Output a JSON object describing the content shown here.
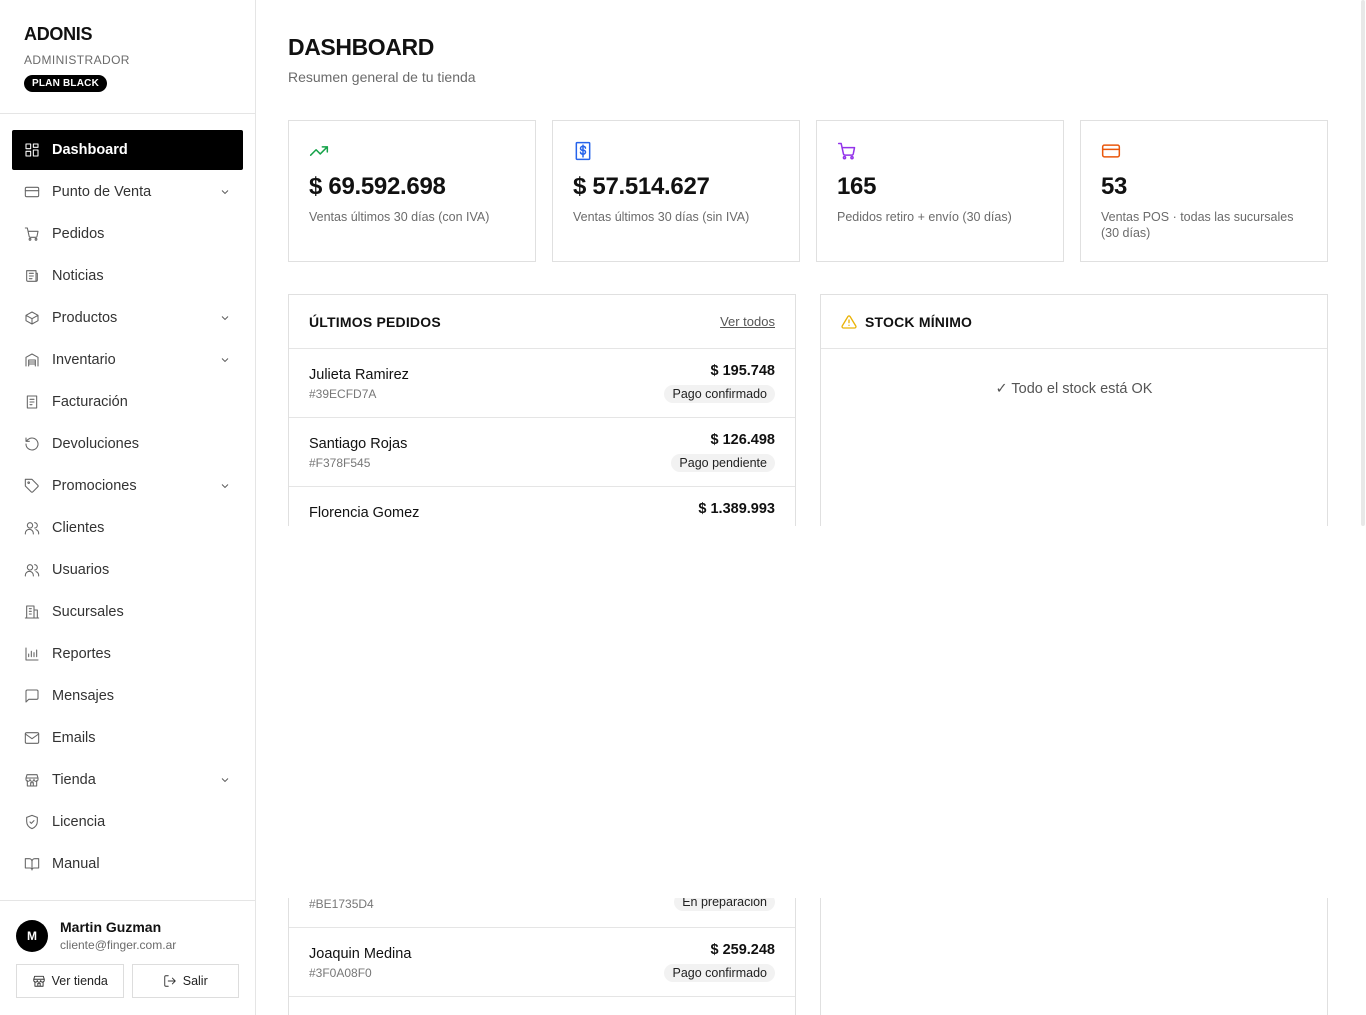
{
  "brand": {
    "name": "ADONIS",
    "role": "ADMINISTRADOR",
    "plan": "PLAN BLACK"
  },
  "nav": [
    {
      "label": "Dashboard",
      "icon": "grid-icon",
      "active": true,
      "expandable": false
    },
    {
      "label": "Punto de Venta",
      "icon": "credit-card-icon",
      "expandable": true
    },
    {
      "label": "Pedidos",
      "icon": "cart-icon",
      "expandable": false
    },
    {
      "label": "Noticias",
      "icon": "newspaper-icon",
      "expandable": false
    },
    {
      "label": "Productos",
      "icon": "box-icon",
      "expandable": true
    },
    {
      "label": "Inventario",
      "icon": "warehouse-icon",
      "expandable": true
    },
    {
      "label": "Facturación",
      "icon": "invoice-icon",
      "expandable": false
    },
    {
      "label": "Devoluciones",
      "icon": "undo-icon",
      "expandable": false
    },
    {
      "label": "Promociones",
      "icon": "tag-icon",
      "expandable": true
    },
    {
      "label": "Clientes",
      "icon": "users-icon",
      "expandable": false
    },
    {
      "label": "Usuarios",
      "icon": "users-icon",
      "expandable": false
    },
    {
      "label": "Sucursales",
      "icon": "building-icon",
      "expandable": false
    },
    {
      "label": "Reportes",
      "icon": "bar-chart-icon",
      "expandable": false
    },
    {
      "label": "Mensajes",
      "icon": "message-icon",
      "expandable": false
    },
    {
      "label": "Emails",
      "icon": "mail-icon",
      "expandable": false
    },
    {
      "label": "Tienda",
      "icon": "store-icon",
      "expandable": true
    },
    {
      "label": "Licencia",
      "icon": "shield-check-icon",
      "expandable": false
    },
    {
      "label": "Manual",
      "icon": "book-icon",
      "expandable": false
    }
  ],
  "user": {
    "initial": "M",
    "name": "Martin Guzman",
    "email": "cliente@finger.com.ar",
    "view_store_label": "Ver tienda",
    "logout_label": "Salir"
  },
  "page": {
    "title": "DASHBOARD",
    "subtitle": "Resumen general de tu tienda"
  },
  "stats": [
    {
      "icon": "trending-up-icon",
      "color": "#16a34a",
      "value": "$ 69.592.698",
      "label": "Ventas últimos 30 días (con IVA)"
    },
    {
      "icon": "dollar-receipt-icon",
      "color": "#2563eb",
      "value": "$ 57.514.627",
      "label": "Ventas últimos 30 días (sin IVA)"
    },
    {
      "icon": "cart-icon",
      "color": "#9333ea",
      "value": "165",
      "label": "Pedidos retiro + envío (30 días)"
    },
    {
      "icon": "credit-card-icon",
      "color": "#ea580c",
      "value": "53",
      "label": "Ventas POS · todas las sucursales (30 días)"
    }
  ],
  "orders_panel": {
    "title": "ÚLTIMOS PEDIDOS",
    "view_all": "Ver todos",
    "orders": [
      {
        "name": "Julieta Ramirez",
        "id": "#39ECFD7A",
        "amount": "$ 195.748",
        "status": "Pago confirmado"
      },
      {
        "name": "Santiago Rojas",
        "id": "#F378F545",
        "amount": "$ 126.498",
        "status": "Pago pendiente"
      },
      {
        "name": "Florencia Gomez",
        "id": "#BE1735D4",
        "amount": "$ 1.389.993",
        "status": "En preparación"
      },
      {
        "name": "Joaquin Medina",
        "id": "#3F0A08F0",
        "amount": "$ 259.248",
        "status": "Pago confirmado"
      }
    ]
  },
  "stock_panel": {
    "title": "STOCK MÍNIMO",
    "icon": "warning-icon",
    "message": "✓ Todo el stock está OK"
  }
}
